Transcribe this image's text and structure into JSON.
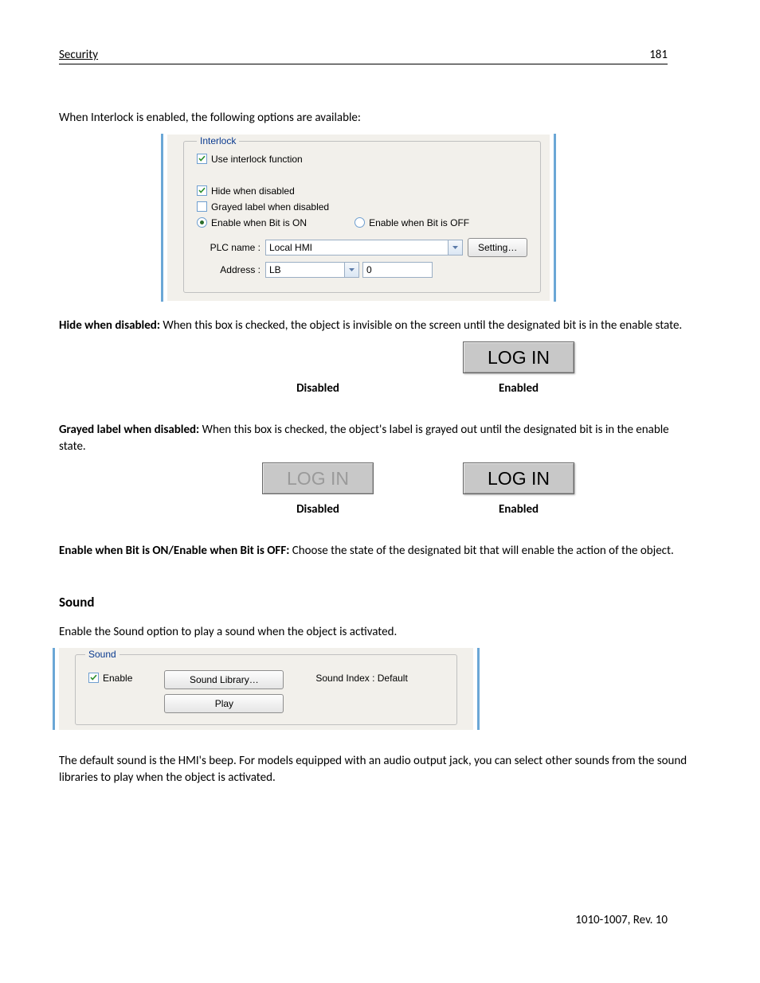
{
  "header": {
    "section": "Security",
    "page_number": "181"
  },
  "intro_text": "When Interlock is enabled, the following options are available:",
  "interlock": {
    "legend": "Interlock",
    "use_interlock": {
      "label": "Use interlock function",
      "checked": true
    },
    "hide_when_disabled": {
      "label": "Hide when disabled",
      "checked": true
    },
    "grayed_label": {
      "label": "Grayed label when disabled",
      "checked": false
    },
    "radio_on": {
      "label": "Enable when Bit is ON",
      "selected": true
    },
    "radio_off": {
      "label": "Enable when Bit is OFF",
      "selected": false
    },
    "plc_label": "PLC name :",
    "plc_value": "Local HMI",
    "setting_btn": "Setting…",
    "address_label": "Address :",
    "address_type": "LB",
    "address_value": "0"
  },
  "para_hide_bold": "Hide when disabled:",
  "para_hide_rest": " When this box is checked, the object is invisible on the screen until the designated bit is in the enable state.",
  "login_text": "LOG IN",
  "caption_disabled": "Disabled",
  "caption_enabled": "Enabled",
  "para_gray_bold": "Grayed label when disabled:",
  "para_gray_rest": " When this box is checked, the object's label is grayed out until the designated bit is in the enable state.",
  "para_enable_bold": "Enable when Bit is ON/Enable when Bit is OFF:",
  "para_enable_rest": " Choose the state of the designated bit that will enable the action of the object.",
  "sound_heading": "Sound",
  "sound_intro": "Enable the Sound option to play a sound when the object is activated.",
  "sound": {
    "legend": "Sound",
    "enable": {
      "label": "Enable",
      "checked": true
    },
    "library_btn": "Sound Library…",
    "play_btn": "Play",
    "index_label": "Sound Index : Default"
  },
  "sound_outro": "The default sound is the HMI's beep. For models equipped with an audio output jack, you can select other sounds from the sound libraries to play when the object is activated.",
  "footer": "1010-1007, Rev. 10"
}
